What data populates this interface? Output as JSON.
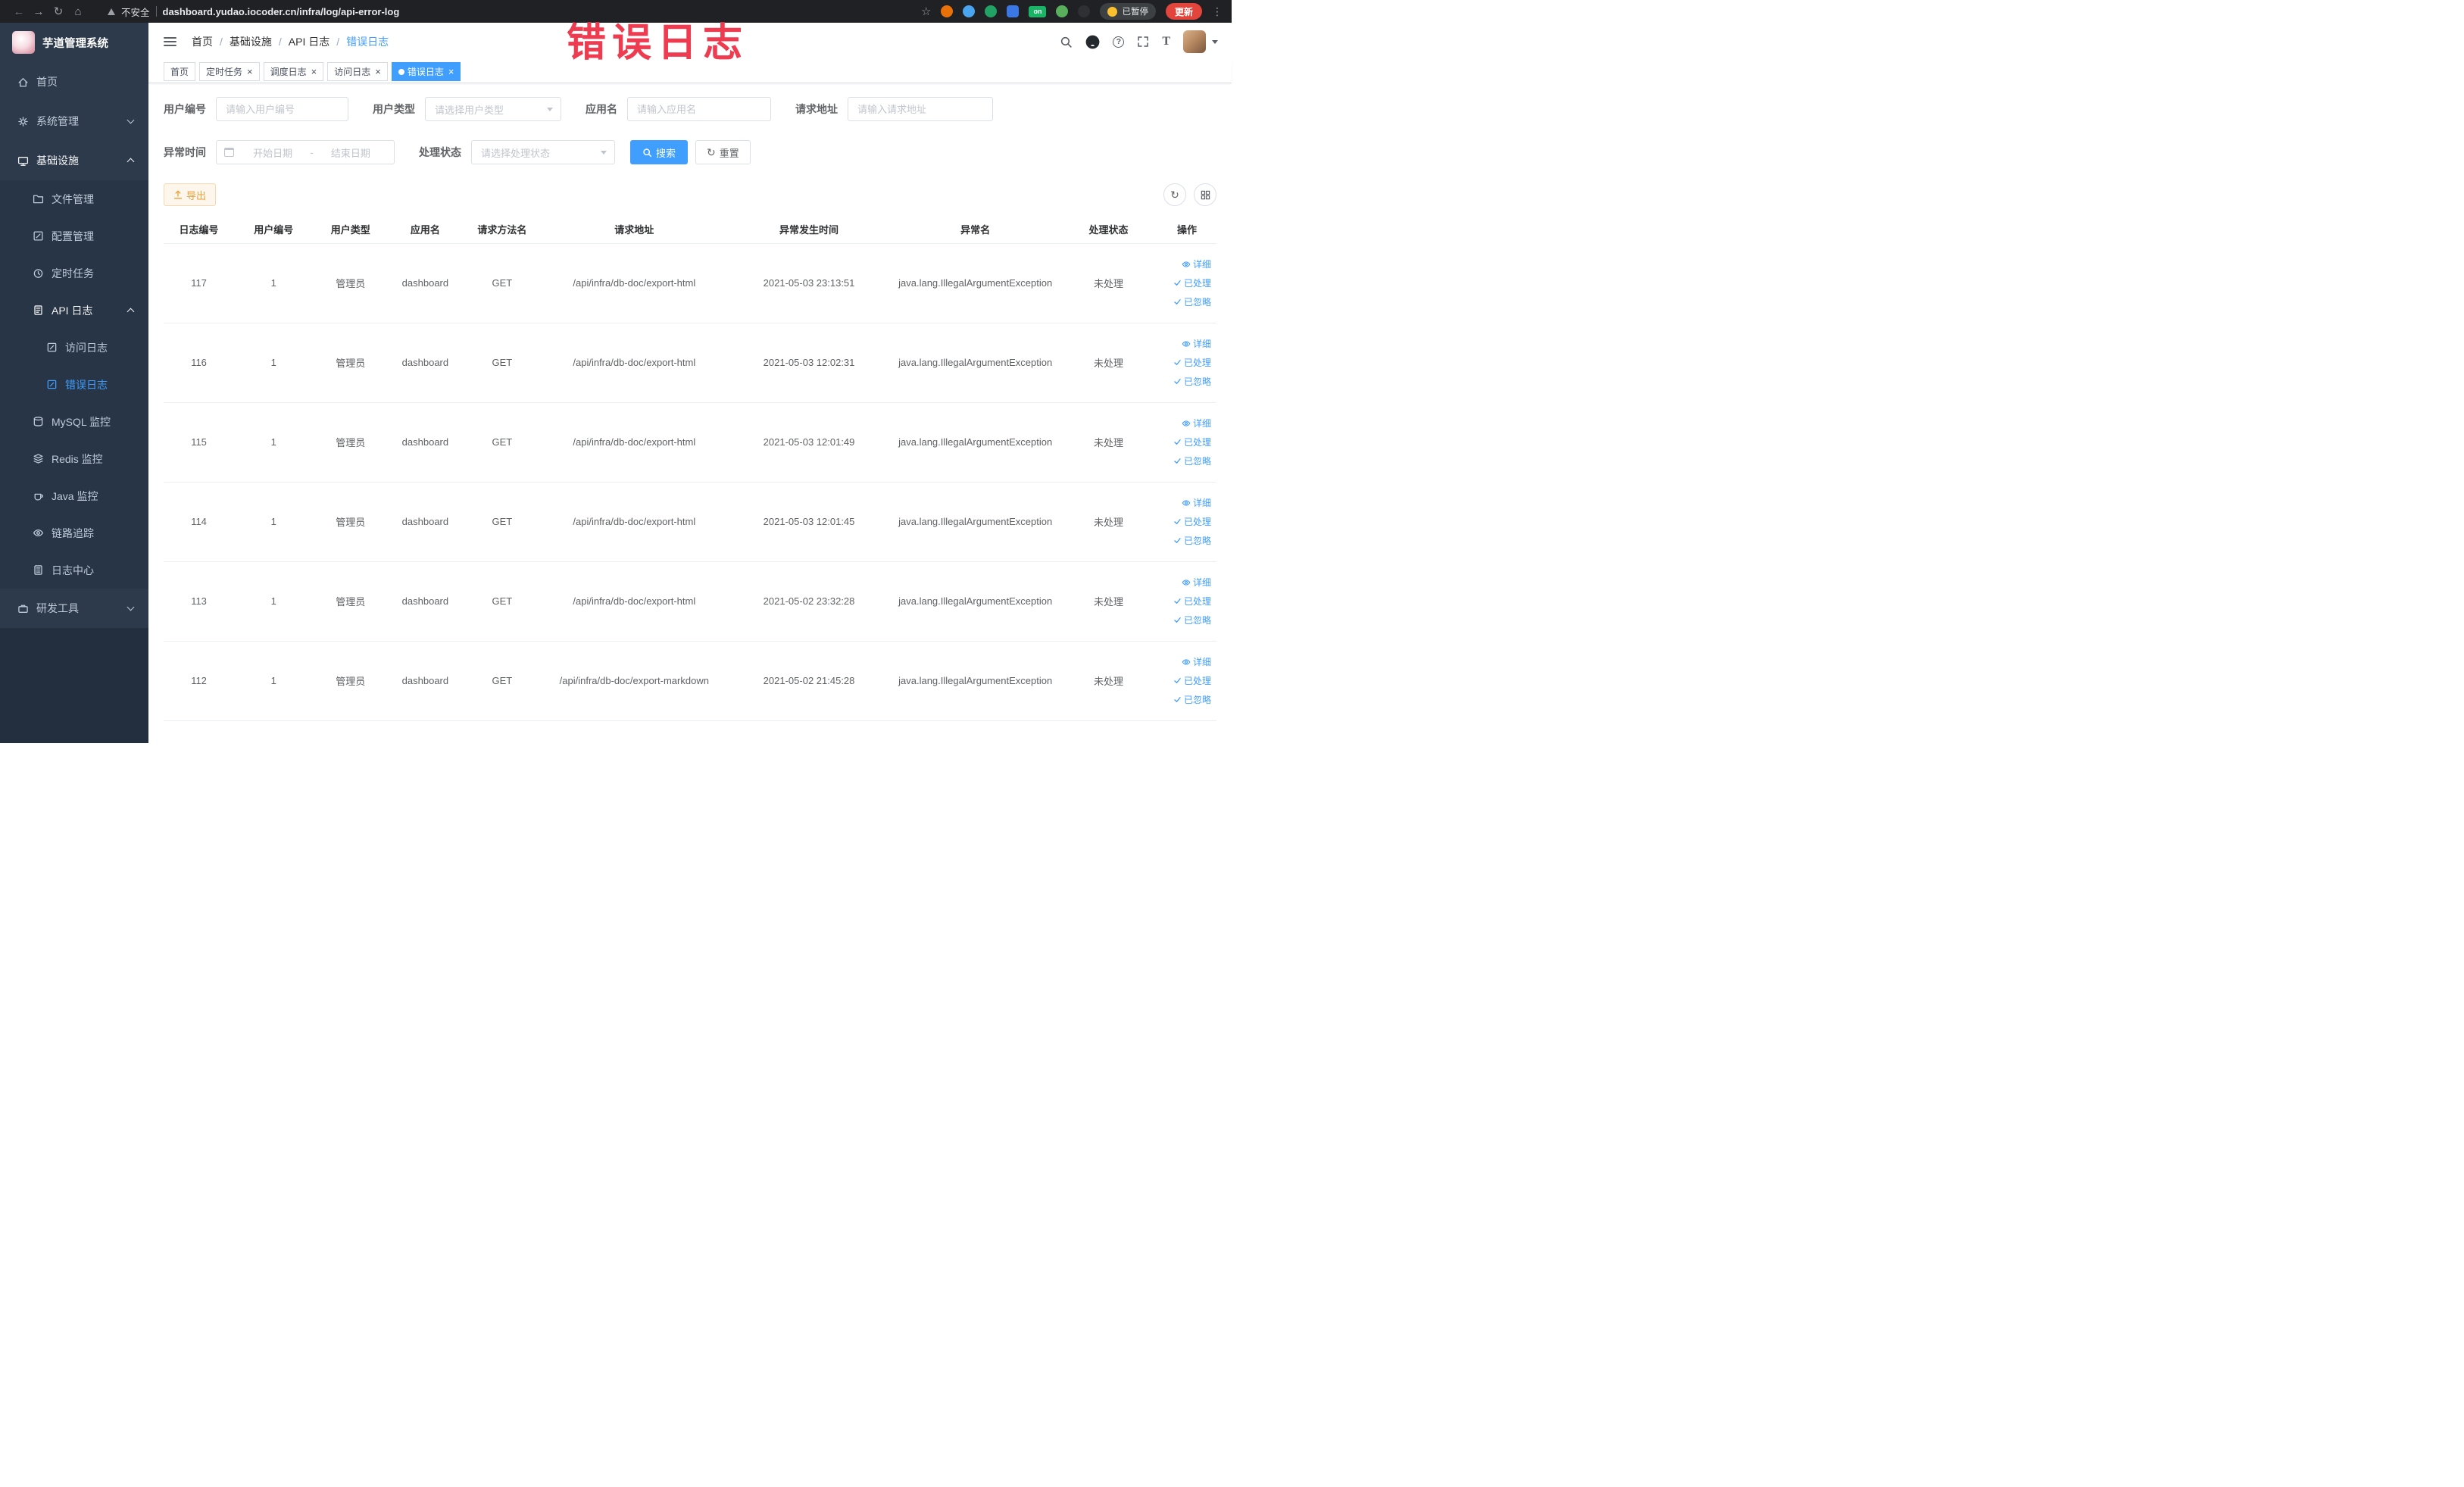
{
  "annotation": {
    "text": "错误日志"
  },
  "colors": {
    "primary": "#409eff",
    "annotation": "#ee3b4f",
    "warning": "#e6a23c",
    "sidebar_bg": "#2d3a4b"
  },
  "browser": {
    "security_label": "不安全",
    "url": "dashboard.yudao.iocoder.cn/infra/log/api-error-log",
    "extension_badge": "on",
    "paused_badge": "已暂停",
    "update_label": "更新"
  },
  "sidebar": {
    "title": "芋道管理系统",
    "items": [
      {
        "key": "home",
        "label": "首页",
        "icon": "home-icon",
        "level": 1
      },
      {
        "key": "system",
        "label": "系统管理",
        "icon": "gear-icon",
        "level": 1,
        "arrow": "down"
      },
      {
        "key": "infra",
        "label": "基础设施",
        "icon": "monitor-icon",
        "level": 1,
        "arrow": "up",
        "trail": true
      },
      {
        "key": "file",
        "label": "文件管理",
        "icon": "folder-icon",
        "level": 2
      },
      {
        "key": "config",
        "label": "配置管理",
        "icon": "config-icon",
        "level": 2
      },
      {
        "key": "job",
        "label": "定时任务",
        "icon": "timer-icon",
        "level": 2
      },
      {
        "key": "api-log",
        "label": "API 日志",
        "icon": "api-log-icon",
        "level": 2,
        "arrow": "up",
        "trail": true
      },
      {
        "key": "access-log",
        "label": "访问日志",
        "icon": "doc-icon",
        "level": 3
      },
      {
        "key": "error-log",
        "label": "错误日志",
        "icon": "doc-icon",
        "level": 3,
        "active": true
      },
      {
        "key": "mysql",
        "label": "MySQL 监控",
        "icon": "database-icon",
        "level": 2
      },
      {
        "key": "redis",
        "label": "Redis 监控",
        "icon": "redis-icon",
        "level": 2
      },
      {
        "key": "java",
        "label": "Java 监控",
        "icon": "java-icon",
        "level": 2
      },
      {
        "key": "tracer",
        "label": "链路追踪",
        "icon": "trace-icon",
        "level": 2
      },
      {
        "key": "log-center",
        "label": "日志中心",
        "icon": "log-center-icon",
        "level": 2
      },
      {
        "key": "dev-tools",
        "label": "研发工具",
        "icon": "tools-icon",
        "level": 1,
        "arrow": "down"
      }
    ]
  },
  "breadcrumb": {
    "separator": "/",
    "items": [
      "首页",
      "基础设施",
      "API 日志",
      "错误日志"
    ]
  },
  "tags": {
    "items": [
      {
        "key": "home",
        "label": "首页",
        "closable": false,
        "active": false
      },
      {
        "key": "job",
        "label": "定时任务",
        "closable": true,
        "active": false
      },
      {
        "key": "job-log",
        "label": "调度日志",
        "closable": true,
        "active": false
      },
      {
        "key": "access-log",
        "label": "访问日志",
        "closable": true,
        "active": false
      },
      {
        "key": "error-log",
        "label": "错误日志",
        "closable": true,
        "active": true
      }
    ]
  },
  "filters": {
    "user_id": {
      "label": "用户编号",
      "placeholder": "请输入用户编号"
    },
    "user_type": {
      "label": "用户类型",
      "placeholder": "请选择用户类型"
    },
    "app_name": {
      "label": "应用名",
      "placeholder": "请输入应用名"
    },
    "request_url": {
      "label": "请求地址",
      "placeholder": "请输入请求地址"
    },
    "exception_time": {
      "label": "异常时间",
      "start_placeholder": "开始日期",
      "separator": "-",
      "end_placeholder": "结束日期"
    },
    "process_status": {
      "label": "处理状态",
      "placeholder": "请选择处理状态"
    },
    "search_label": "搜索",
    "reset_label": "重置"
  },
  "toolbar": {
    "export_label": "导出"
  },
  "table": {
    "columns": [
      "日志编号",
      "用户编号",
      "用户类型",
      "应用名",
      "请求方法名",
      "请求地址",
      "异常发生时间",
      "异常名",
      "处理状态",
      "操作"
    ],
    "action_labels": [
      "详细",
      "已处理",
      "已忽略"
    ],
    "rows": [
      {
        "id": "117",
        "user_id": "1",
        "user_type": "管理员",
        "app": "dashboard",
        "method": "GET",
        "url": "/api/infra/db-doc/export-html",
        "time": "2021-05-03 23:13:51",
        "exception": "java.lang.IllegalArgumentException",
        "status": "未处理"
      },
      {
        "id": "116",
        "user_id": "1",
        "user_type": "管理员",
        "app": "dashboard",
        "method": "GET",
        "url": "/api/infra/db-doc/export-html",
        "time": "2021-05-03 12:02:31",
        "exception": "java.lang.IllegalArgumentException",
        "status": "未处理"
      },
      {
        "id": "115",
        "user_id": "1",
        "user_type": "管理员",
        "app": "dashboard",
        "method": "GET",
        "url": "/api/infra/db-doc/export-html",
        "time": "2021-05-03 12:01:49",
        "exception": "java.lang.IllegalArgumentException",
        "status": "未处理"
      },
      {
        "id": "114",
        "user_id": "1",
        "user_type": "管理员",
        "app": "dashboard",
        "method": "GET",
        "url": "/api/infra/db-doc/export-html",
        "time": "2021-05-03 12:01:45",
        "exception": "java.lang.IllegalArgumentException",
        "status": "未处理"
      },
      {
        "id": "113",
        "user_id": "1",
        "user_type": "管理员",
        "app": "dashboard",
        "method": "GET",
        "url": "/api/infra/db-doc/export-html",
        "time": "2021-05-02 23:32:28",
        "exception": "java.lang.IllegalArgumentException",
        "status": "未处理"
      },
      {
        "id": "112",
        "user_id": "1",
        "user_type": "管理员",
        "app": "dashboard",
        "method": "GET",
        "url": "/api/infra/db-doc/export-markdown",
        "time": "2021-05-02 21:45:28",
        "exception": "java.lang.IllegalArgumentException",
        "status": "未处理"
      }
    ]
  }
}
